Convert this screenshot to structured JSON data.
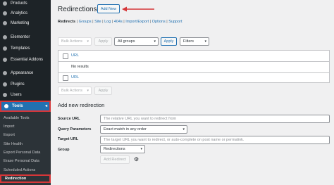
{
  "sidebar": {
    "items": [
      {
        "label": "Products",
        "icon": "products-icon"
      },
      {
        "label": "Analytics",
        "icon": "analytics-icon"
      },
      {
        "label": "Marketing",
        "icon": "marketing-icon"
      },
      {
        "label": "Elementor",
        "icon": "elementor-icon"
      },
      {
        "label": "Templates",
        "icon": "templates-icon"
      },
      {
        "label": "Essential Addons",
        "icon": "addons-icon"
      },
      {
        "label": "Appearance",
        "icon": "appearance-icon"
      },
      {
        "label": "Plugins",
        "icon": "plugins-icon"
      },
      {
        "label": "Users",
        "icon": "users-icon"
      },
      {
        "label": "Tools",
        "icon": "tools-icon"
      }
    ],
    "submenu": [
      "Available Tools",
      "Import",
      "Export",
      "Site Health",
      "Export Personal Data",
      "Erase Personal Data",
      "Scheduled Actions",
      "Redirection"
    ]
  },
  "header": {
    "title": "Redirections",
    "add_new": "Add New"
  },
  "subnav": {
    "items": [
      "Redirects",
      "Groups",
      "Site",
      "Log",
      "404s",
      "Import/Export",
      "Options",
      "Support"
    ],
    "separator": "|"
  },
  "filters": {
    "bulk_actions": "Bulk Actions",
    "apply": "Apply",
    "group_filter": "All groups",
    "apply2": "Apply",
    "filters": "Filters"
  },
  "table": {
    "header": "URL",
    "empty": "No results",
    "footer": "URL"
  },
  "bottom_bar": {
    "bulk_actions": "Bulk Actions",
    "apply": "Apply"
  },
  "form": {
    "heading": "Add new redirection",
    "source_label": "Source URL",
    "source_placeholder": "The relative URL you want to redirect from",
    "query_label": "Query Parameters",
    "query_value": "Exact match in any order",
    "target_label": "Target URL",
    "target_placeholder": "The target URL you want to redirect, or auto-complete on post name or permalink.",
    "group_label": "Group",
    "group_value": "Redirections",
    "submit": "Add Redirect"
  },
  "colors": {
    "accent": "#2271b1",
    "highlight": "#d63638",
    "sidebar": "#1d2327"
  }
}
